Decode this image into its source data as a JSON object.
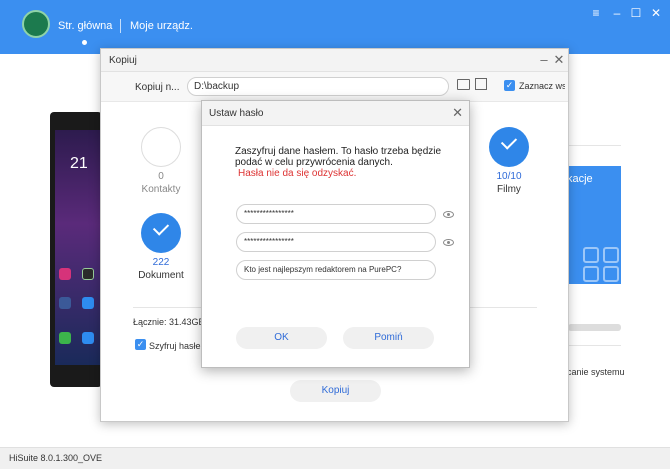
{
  "app": {
    "nav_main": "Str. główna",
    "nav_devices": "Moje urządz.",
    "accent": "#3b8ff0",
    "version": "HiSuite 8.0.1.300_OVE"
  },
  "background": {
    "phone_clock": "21",
    "card_text": "kacje",
    "system_text": "canie systemu"
  },
  "kopiuj_window": {
    "title": "Kopiuj",
    "path_label": "Kopiuj n...",
    "path_value": "D:\\backup",
    "select_all_label": "Zaznacz wszystko",
    "categories": [
      {
        "name": "Kontakty",
        "count": "0",
        "selected": false
      },
      {
        "name": "Filmy",
        "count": "10/10",
        "selected": true
      },
      {
        "name": "Dokument",
        "count": "222",
        "selected": true
      }
    ],
    "total_label": "Łącznie: 31.43GB",
    "encrypt_label": "Szyfruj hasłem",
    "copy_button": "Kopiuj"
  },
  "dialog": {
    "title": "Ustaw hasło",
    "message": "Zaszyfruj dane hasłem. To hasło trzeba będzie podać w celu przywrócenia danych.",
    "warning": "Hasła nie da się odzyskać.",
    "password_value": "****************",
    "confirm_value": "****************",
    "hint_value": "Kto jest najlepszym redaktorem na PurePC?",
    "ok_button": "OK",
    "skip_button": "Pomiń"
  }
}
